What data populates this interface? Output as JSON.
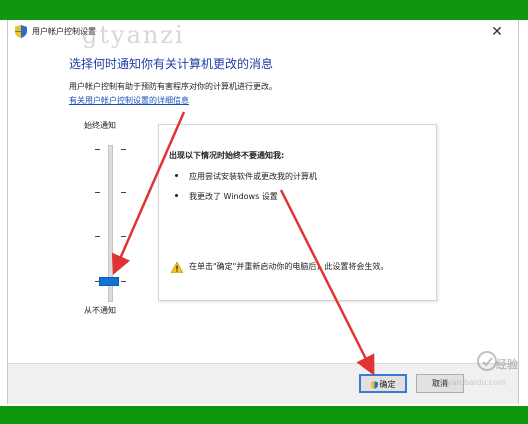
{
  "window": {
    "title": "用户帐户控制设置",
    "watermark": "gtyanzi",
    "close_glyph": "✕"
  },
  "main": {
    "heading": "选择何时通知你有关计算机更改的消息",
    "description": "用户帐户控制有助于预防有害程序对你的计算机进行更改。",
    "link": "有关用户帐户控制设置的详细信息"
  },
  "slider": {
    "top_label": "始终通知",
    "bottom_label": "从不通知",
    "levels": 4,
    "selected_level": 1
  },
  "info_box": {
    "heading": "出现以下情况时始终不要通知我:",
    "bullets": [
      "应用尝试安装软件或更改我的计算机",
      "我更改了 Windows 设置"
    ],
    "warning": "在单击\"确定\"并重新启动你的电脑后，此设置将会生效。"
  },
  "footer": {
    "ok_label": "确定",
    "cancel_label": "取消"
  },
  "overlay": {
    "jy_text": "经验",
    "jy_sub": "jingyan.baidu.com"
  },
  "colors": {
    "frame_green": "#10960f",
    "heading_blue": "#1f3ea6",
    "link_blue": "#1a52b7",
    "thumb_blue": "#1173d3",
    "arrow_red": "#e03434"
  }
}
